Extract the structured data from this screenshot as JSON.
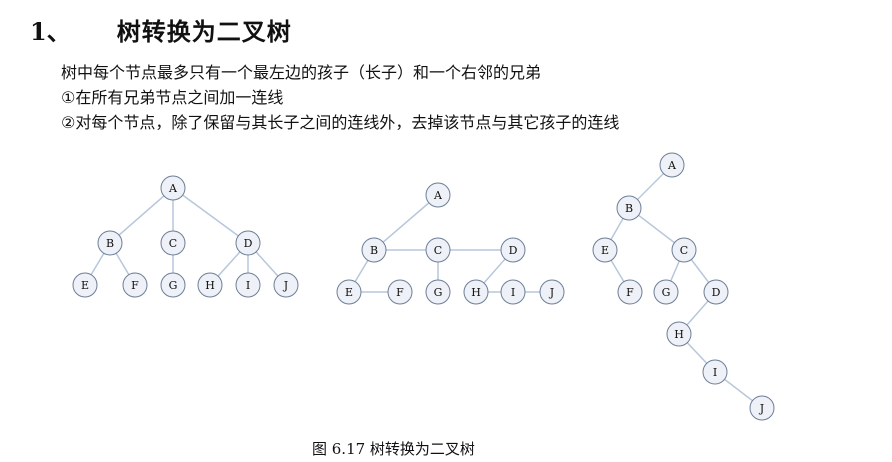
{
  "heading": {
    "number": "1、",
    "title": "树转换为二叉树"
  },
  "lines": [
    "树中每个节点最多只有一个最左边的孩子（长子）和一个右邻的兄弟",
    "①在所有兄弟节点之间加一连线",
    "②对每个节点，除了保留与其长子之间的连线外，去掉该节点与其它孩子的连线"
  ],
  "caption": "图 6.17  树转换为二叉树",
  "colors": {
    "edge": "#b7c7dc",
    "node_fill": "#eef1f7",
    "node_stroke": "#6e7e96",
    "text": "#111111"
  },
  "diagrams": [
    {
      "name": "original-tree",
      "nodes": [
        "A",
        "B",
        "C",
        "D",
        "E",
        "F",
        "G",
        "H",
        "I",
        "J"
      ],
      "edges": [
        [
          "A",
          "B"
        ],
        [
          "A",
          "C"
        ],
        [
          "A",
          "D"
        ],
        [
          "B",
          "E"
        ],
        [
          "B",
          "F"
        ],
        [
          "C",
          "G"
        ],
        [
          "D",
          "H"
        ],
        [
          "D",
          "I"
        ],
        [
          "D",
          "J"
        ]
      ]
    },
    {
      "name": "sibling-connected-tree",
      "nodes": [
        "A",
        "B",
        "C",
        "D",
        "E",
        "F",
        "G",
        "H",
        "I",
        "J"
      ],
      "edges": [
        [
          "A",
          "B"
        ],
        [
          "B",
          "C"
        ],
        [
          "C",
          "D"
        ],
        [
          "B",
          "E"
        ],
        [
          "E",
          "F"
        ],
        [
          "C",
          "G"
        ],
        [
          "D",
          "H"
        ],
        [
          "H",
          "I"
        ],
        [
          "I",
          "J"
        ]
      ]
    },
    {
      "name": "binary-tree",
      "nodes": [
        "A",
        "B",
        "C",
        "D",
        "E",
        "F",
        "G",
        "H",
        "I",
        "J"
      ],
      "edges": [
        [
          "A",
          "B"
        ],
        [
          "B",
          "E"
        ],
        [
          "B",
          "C"
        ],
        [
          "E",
          "F"
        ],
        [
          "C",
          "G"
        ],
        [
          "C",
          "D"
        ],
        [
          "D",
          "H"
        ],
        [
          "H",
          "I"
        ],
        [
          "I",
          "J"
        ]
      ]
    }
  ]
}
